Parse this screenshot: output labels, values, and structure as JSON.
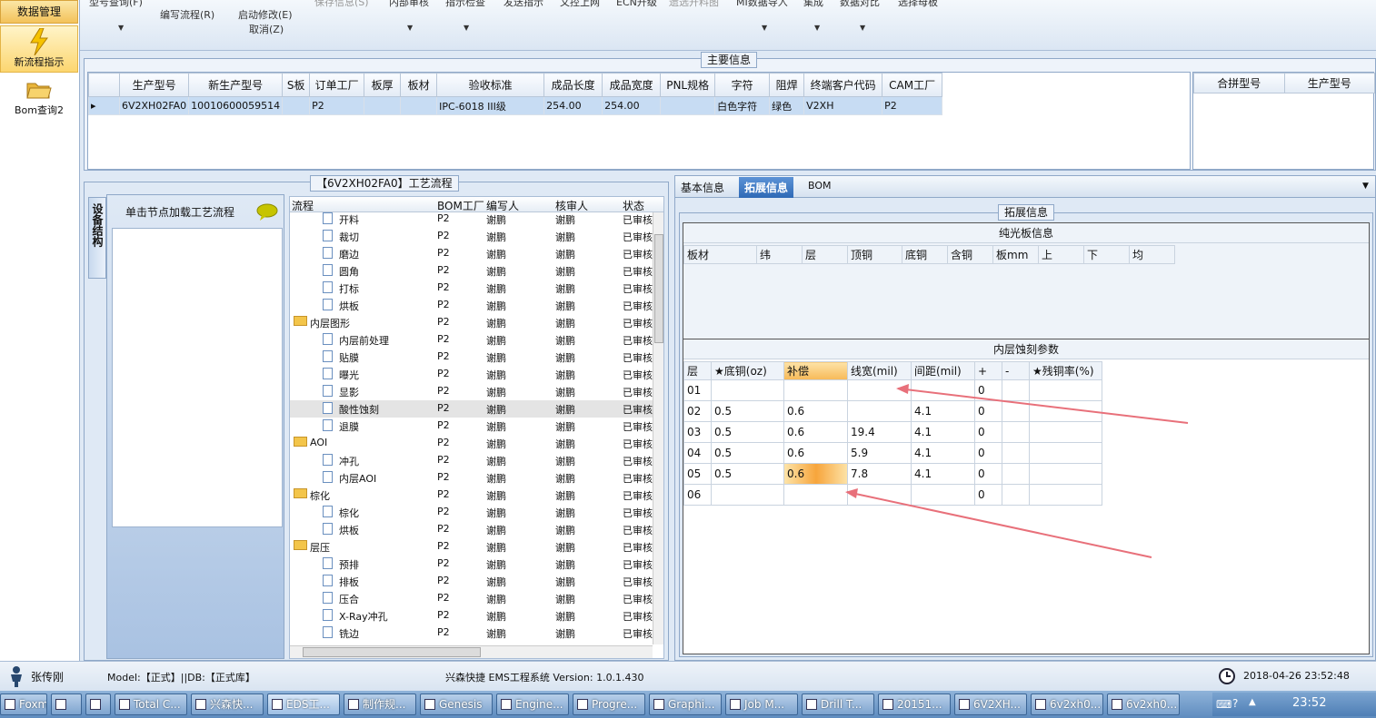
{
  "nav": {
    "header": "数据管理",
    "items": [
      {
        "label": "新流程指示",
        "icon": "lightning-icon"
      },
      {
        "label": "Bom查询2",
        "icon": "folder-open-icon"
      }
    ]
  },
  "toolbar": {
    "items": [
      {
        "label": "型号查询(F)",
        "dim": false
      },
      {
        "label": "编写流程(R)",
        "dim": false
      },
      {
        "label": "启动修改(E)",
        "dim": false
      },
      {
        "label": "取消(Z)",
        "dim": false
      },
      {
        "label": "保存信息(S)",
        "dim": true
      },
      {
        "label": "内部审核",
        "dim": false
      },
      {
        "label": "指示检查",
        "dim": false
      },
      {
        "label": "发送指示",
        "dim": false
      },
      {
        "label": "文控上网",
        "dim": false
      },
      {
        "label": "ECN升级",
        "dim": false
      },
      {
        "label": "遗选开料图",
        "dim": true
      },
      {
        "label": "MI数据导入",
        "dim": false
      },
      {
        "label": "集成",
        "dim": false
      },
      {
        "label": "数据对比",
        "dim": false
      },
      {
        "label": "选择母板",
        "dim": false
      }
    ]
  },
  "main_info": {
    "title": "主要信息",
    "columns": [
      "生产型号",
      "新生产型号",
      "S板",
      "订单工厂",
      "板厚",
      "板材",
      "验收标准",
      "成品长度",
      "成品宽度",
      "PNL规格",
      "字符",
      "阻焊",
      "终端客户代码",
      "CAM工厂"
    ],
    "row": [
      "6V2XH02FA0",
      "10010600059514",
      "",
      "P2",
      "",
      "",
      "IPC-6018 III级",
      "254.00",
      "254.00",
      "",
      "白色字符",
      "绿色",
      "V2XH",
      "P2"
    ],
    "merge_columns": [
      "合拼型号",
      "生产型号"
    ]
  },
  "process": {
    "title": "【6V2XH02FA0】工艺流程",
    "side_tab": "设备结构",
    "hint": "单击节点加载工艺流程",
    "columns": [
      "流程",
      "BOM工厂",
      "编写人",
      "核审人",
      "状态"
    ],
    "rows": [
      {
        "name": "开料",
        "level": 2,
        "type": "file",
        "factory": "P2",
        "author": "谢鹏",
        "reviewer": "谢鹏",
        "status": "已审核"
      },
      {
        "name": "裁切",
        "level": 2,
        "type": "file",
        "factory": "P2",
        "author": "谢鹏",
        "reviewer": "谢鹏",
        "status": "已审核"
      },
      {
        "name": "磨边",
        "level": 2,
        "type": "file",
        "factory": "P2",
        "author": "谢鹏",
        "reviewer": "谢鹏",
        "status": "已审核"
      },
      {
        "name": "圆角",
        "level": 2,
        "type": "file",
        "factory": "P2",
        "author": "谢鹏",
        "reviewer": "谢鹏",
        "status": "已审核"
      },
      {
        "name": "打标",
        "level": 2,
        "type": "file",
        "factory": "P2",
        "author": "谢鹏",
        "reviewer": "谢鹏",
        "status": "已审核"
      },
      {
        "name": "烘板",
        "level": 2,
        "type": "file",
        "factory": "P2",
        "author": "谢鹏",
        "reviewer": "谢鹏",
        "status": "已审核"
      },
      {
        "name": "内层图形",
        "level": 1,
        "type": "folder",
        "factory": "P2",
        "author": "谢鹏",
        "reviewer": "谢鹏",
        "status": "已审核"
      },
      {
        "name": "内层前处理",
        "level": 2,
        "type": "file",
        "factory": "P2",
        "author": "谢鹏",
        "reviewer": "谢鹏",
        "status": "已审核"
      },
      {
        "name": "贴膜",
        "level": 2,
        "type": "file",
        "factory": "P2",
        "author": "谢鹏",
        "reviewer": "谢鹏",
        "status": "已审核"
      },
      {
        "name": "曝光",
        "level": 2,
        "type": "file",
        "factory": "P2",
        "author": "谢鹏",
        "reviewer": "谢鹏",
        "status": "已审核"
      },
      {
        "name": "显影",
        "level": 2,
        "type": "file",
        "factory": "P2",
        "author": "谢鹏",
        "reviewer": "谢鹏",
        "status": "已审核"
      },
      {
        "name": "酸性蚀刻",
        "level": 2,
        "type": "file",
        "factory": "P2",
        "author": "谢鹏",
        "reviewer": "谢鹏",
        "status": "已审核",
        "selected": true
      },
      {
        "name": "退膜",
        "level": 2,
        "type": "file",
        "factory": "P2",
        "author": "谢鹏",
        "reviewer": "谢鹏",
        "status": "已审核"
      },
      {
        "name": "AOI",
        "level": 1,
        "type": "folder",
        "factory": "P2",
        "author": "谢鹏",
        "reviewer": "谢鹏",
        "status": "已审核"
      },
      {
        "name": "冲孔",
        "level": 2,
        "type": "file",
        "factory": "P2",
        "author": "谢鹏",
        "reviewer": "谢鹏",
        "status": "已审核"
      },
      {
        "name": "内层AOI",
        "level": 2,
        "type": "file",
        "factory": "P2",
        "author": "谢鹏",
        "reviewer": "谢鹏",
        "status": "已审核"
      },
      {
        "name": "棕化",
        "level": 1,
        "type": "folder",
        "factory": "P2",
        "author": "谢鹏",
        "reviewer": "谢鹏",
        "status": "已审核"
      },
      {
        "name": "棕化",
        "level": 2,
        "type": "file",
        "factory": "P2",
        "author": "谢鹏",
        "reviewer": "谢鹏",
        "status": "已审核"
      },
      {
        "name": "烘板",
        "level": 2,
        "type": "file",
        "factory": "P2",
        "author": "谢鹏",
        "reviewer": "谢鹏",
        "status": "已审核"
      },
      {
        "name": "层压",
        "level": 1,
        "type": "folder",
        "factory": "P2",
        "author": "谢鹏",
        "reviewer": "谢鹏",
        "status": "已审核"
      },
      {
        "name": "预排",
        "level": 2,
        "type": "file",
        "factory": "P2",
        "author": "谢鹏",
        "reviewer": "谢鹏",
        "status": "已审核"
      },
      {
        "name": "排板",
        "level": 2,
        "type": "file",
        "factory": "P2",
        "author": "谢鹏",
        "reviewer": "谢鹏",
        "status": "已审核"
      },
      {
        "name": "压合",
        "level": 2,
        "type": "file",
        "factory": "P2",
        "author": "谢鹏",
        "reviewer": "谢鹏",
        "status": "已审核"
      },
      {
        "name": "X-Ray冲孔",
        "level": 2,
        "type": "file",
        "factory": "P2",
        "author": "谢鹏",
        "reviewer": "谢鹏",
        "status": "已审核"
      },
      {
        "name": "铣边",
        "level": 2,
        "type": "file",
        "factory": "P2",
        "author": "谢鹏",
        "reviewer": "谢鹏",
        "status": "已审核"
      }
    ]
  },
  "tabs": {
    "items": [
      "基本信息",
      "拓展信息",
      "BOM"
    ],
    "active": 1
  },
  "extended": {
    "title": "拓展信息",
    "plain_board": {
      "title": "纯光板信息",
      "columns": [
        "板材",
        "纬",
        "层",
        "顶铜",
        "底铜",
        "含铜",
        "板mm",
        "上",
        "下",
        "均"
      ]
    },
    "etch": {
      "title": "内层蚀刻参数",
      "columns": [
        "层",
        "★底铜(oz)",
        "补偿",
        "线宽(mil)",
        "间距(mil)",
        "+",
        "-",
        "★残铜率(%)"
      ],
      "rows": [
        [
          "01",
          "",
          "",
          "",
          "",
          "0",
          "",
          ""
        ],
        [
          "02",
          "0.5",
          "0.6",
          "",
          "4.1",
          "0",
          "",
          ""
        ],
        [
          "03",
          "0.5",
          "0.6",
          "19.4",
          "4.1",
          "0",
          "",
          ""
        ],
        [
          "04",
          "0.5",
          "0.6",
          "5.9",
          "4.1",
          "0",
          "",
          ""
        ],
        [
          "05",
          "0.5",
          "0.6",
          "7.8",
          "4.1",
          "0",
          "",
          ""
        ],
        [
          "06",
          "",
          "",
          "",
          "",
          "0",
          "",
          ""
        ]
      ]
    }
  },
  "status": {
    "user": "张传刚",
    "model": "Model:【正式】||DB:【正式库】",
    "system": "兴森快捷 EMS工程系统 Version: 1.0.1.430",
    "datetime": "2018-04-26 23:52:48"
  },
  "taskbar": {
    "items": [
      "Foxmail",
      "",
      "",
      "Total C...",
      "兴森快...",
      "EDS工...",
      "制作规...",
      "Genesis",
      "Engine...",
      "Progre...",
      "Graphi...",
      "Job M...",
      "Drill T...",
      "20151...",
      "6V2XH...",
      "6v2xh0...",
      "6v2xh0..."
    ],
    "clock": "23:52"
  }
}
